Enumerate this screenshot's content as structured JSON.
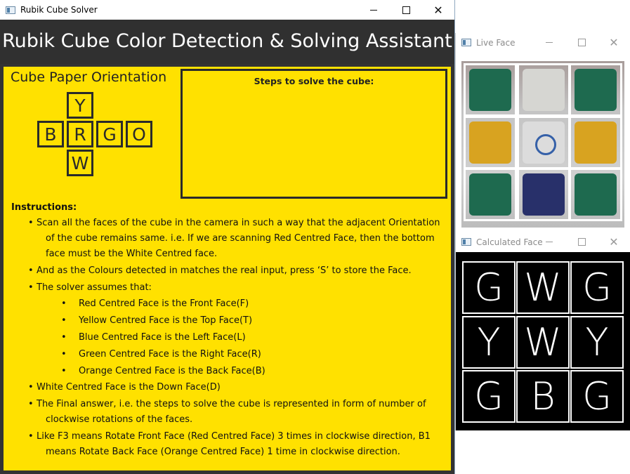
{
  "main_window": {
    "title": "Rubik Cube Solver",
    "header": "Rubik Cube Color Detection & Solving Assistant",
    "orientation_title": "Cube Paper Orientation",
    "net": {
      "top": "Y",
      "left": "B",
      "front": "R",
      "right": "G",
      "back": "O",
      "bottom": "W"
    },
    "steps_title": "Steps to solve the cube:",
    "instructions": {
      "heading": "Instructions:",
      "b1_line1": "Scan all the faces of the cube in the camera in such a way that the adjacent Orientation",
      "b1_line2": "of the cube remains same. i.e. If we are scanning Red Centred Face, then the bottom",
      "b1_line3": "face must be the White Centred face.",
      "b2": "And as the Colours detected in matches the real input, press ‘S’ to store the Face.",
      "b3": "The  solver assumes that:",
      "sub": [
        "Red Centred Face is the Front Face(F)",
        "Yellow Centred Face is the Top Face(T)",
        "Blue Centred Face is the Left Face(L)",
        "Green Centred Face is the Right Face(R)",
        "Orange Centred Face is the Back Face(B)"
      ],
      "b4": "White Centred Face is the Down Face(D)",
      "b5_line1": "The Final answer, i.e. the steps to solve the cube is represented in form of number of",
      "b5_line2": "clockwise rotations of the faces.",
      "b6_line1": "Like F3 means Rotate Front Face (Red Centred Face) 3 times in clockwise direction, B1",
      "b6_line2": "means Rotate Back Face (Orange Centred Face) 1 time in clockwise direction."
    }
  },
  "live_window": {
    "title": "Live Face",
    "stickers": [
      "green",
      "white",
      "green",
      "yellow",
      "center-logo",
      "yellow",
      "green",
      "blue",
      "green"
    ]
  },
  "calc_window": {
    "title": "Calculated Face",
    "cells": [
      "G",
      "W",
      "G",
      "Y",
      "W",
      "Y",
      "G",
      "B",
      "G"
    ]
  },
  "colors": {
    "panel_yellow": "#ffe100",
    "header_dark": "#303030",
    "sticker_green": "#1e6a4f",
    "sticker_yellow": "#d8a320",
    "sticker_blue": "#28306a"
  },
  "icons": [
    "window-app-icon",
    "minimize-icon",
    "maximize-icon",
    "close-icon"
  ]
}
